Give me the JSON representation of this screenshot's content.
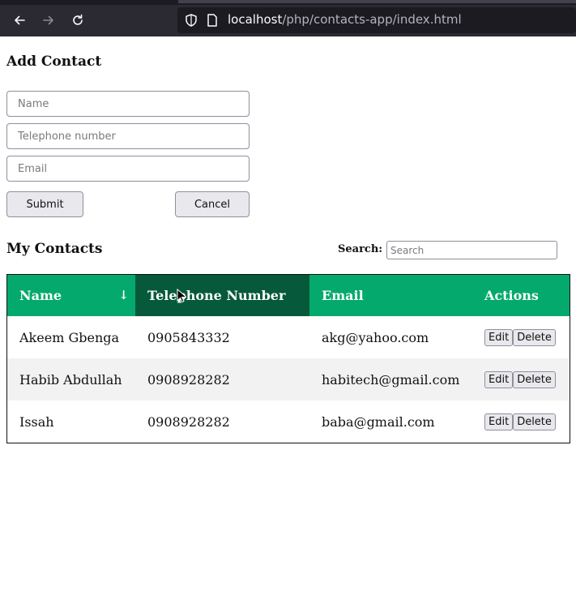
{
  "browser": {
    "url_host": "localhost",
    "url_path": "/php/contacts-app/index.html"
  },
  "add_contact": {
    "title": "Add Contact",
    "name_placeholder": "Name",
    "tel_placeholder": "Telephone number",
    "email_placeholder": "Email",
    "submit_label": "Submit",
    "cancel_label": "Cancel"
  },
  "contacts": {
    "title": "My Contacts",
    "search_label": "Search:",
    "search_placeholder": "Search",
    "headers": {
      "name": "Name",
      "sort_indicator": "↓",
      "telephone": "Telephone Number",
      "email": "Email",
      "actions": "Actions"
    },
    "edit_label": "Edit",
    "delete_label": "Delete",
    "rows": [
      {
        "name": "Akeem Gbenga",
        "telephone": "0905843332",
        "email": "akg@yahoo.com"
      },
      {
        "name": "Habib Abdullah",
        "telephone": "0908928282",
        "email": "habitech@gmail.com"
      },
      {
        "name": "Issah",
        "telephone": "0908928282",
        "email": "baba@gmail.com"
      }
    ]
  },
  "colors": {
    "header_green": "#04aa6d",
    "header_active": "#065a3b",
    "row_alt": "#f2f2f2"
  }
}
